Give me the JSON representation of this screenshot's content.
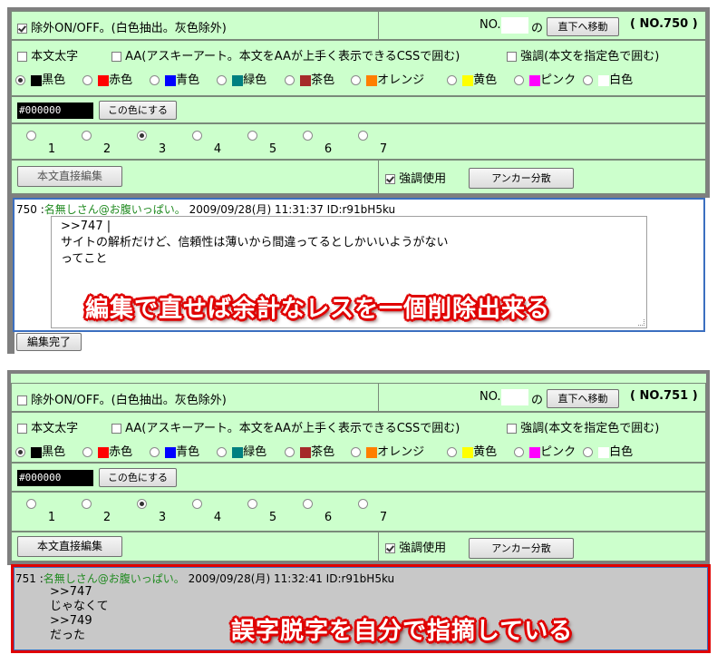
{
  "panel1": {
    "exclude_label": "除外ON/OFF。(白色抽出。灰色除外)",
    "no_prefix": "NO.",
    "no_suffix": "の",
    "jump_button": "直下へ移動",
    "post_no": "( NO.750 )",
    "bold_label": "本文太字",
    "aa_label": "AA(アスキーアート。本文をAAが上手く表示できるCSSで囲む)",
    "emph_label": "強調(本文を指定色で囲む)",
    "colors": [
      {
        "name": "黒色",
        "hex": "#000000",
        "selected": true
      },
      {
        "name": "赤色",
        "hex": "#ff0000"
      },
      {
        "name": "青色",
        "hex": "#0000ff"
      },
      {
        "name": "緑色",
        "hex": "#008080"
      },
      {
        "name": "茶色",
        "hex": "#a52a2a"
      },
      {
        "name": "オレンジ",
        "hex": "#ff7f00"
      },
      {
        "name": "黄色",
        "hex": "#ffff00"
      },
      {
        "name": "ピンク",
        "hex": "#ff00ff"
      },
      {
        "name": "白色",
        "hex": "#ffffff"
      }
    ],
    "color_value": "#000000",
    "apply_color_button": "この色にする",
    "scale": [
      "1",
      "2",
      "3",
      "4",
      "5",
      "6",
      "7"
    ],
    "scale_selected": "3",
    "direct_edit_button": "本文直接編集",
    "emph_use_label": "強調使用",
    "anchor_button": "アンカー分散"
  },
  "post1": {
    "number": "750",
    "name": "名無しさん@お腹いっぱい。",
    "datetime": "2009/09/28(月) 11:31:37 ID:r91bH5ku",
    "body_lines": [
      ">>747 |",
      "サイトの解析だけど、信頼性は薄いから間違ってるとしかいいようがない",
      "ってこと"
    ],
    "edit_done_button": "編集完了",
    "caption": "編集で直せば余計なレスを一個削除出来る"
  },
  "panel2": {
    "exclude_label": "除外ON/OFF。(白色抽出。灰色除外)",
    "no_prefix": "NO.",
    "no_suffix": "の",
    "jump_button": "直下へ移動",
    "post_no": "( NO.751 )",
    "bold_label": "本文太字",
    "aa_label": "AA(アスキーアート。本文をAAが上手く表示できるCSSで囲む)",
    "emph_label": "強調(本文を指定色で囲む)",
    "color_value": "#000000",
    "apply_color_button": "この色にする",
    "direct_edit_button": "本文直接編集",
    "emph_use_label": "強調使用",
    "anchor_button": "アンカー分散"
  },
  "post2": {
    "number": "751",
    "name": "名無しさん@お腹いっぱい。",
    "datetime": "2009/09/28(月) 11:32:41 ID:r91bH5ku",
    "body_lines": [
      ">>747",
      "じゃなくて",
      ">>749",
      "だった"
    ],
    "caption": "誤字脱字を自分で指摘している"
  }
}
